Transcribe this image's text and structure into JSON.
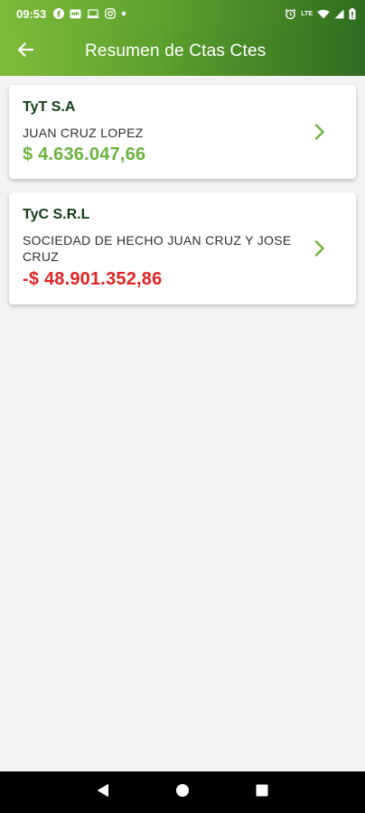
{
  "status_bar": {
    "time": "09:53",
    "network_label": "LTE",
    "icons": [
      "facebook-icon",
      "messages-icon",
      "laptop-icon",
      "instagram-icon",
      "dot-icon",
      "alarm-icon",
      "wifi-icon",
      "signal-icon",
      "battery-icon"
    ]
  },
  "app_bar": {
    "title": "Resumen de Ctas Ctes",
    "back_icon": "arrow-left-icon"
  },
  "accounts": [
    {
      "company": "TyT S.A",
      "holder": "JUAN CRUZ LOPEZ",
      "balance": "$ 4.636.047,66",
      "balance_color": "#6db33f"
    },
    {
      "company": "TyC S.R.L",
      "holder": "SOCIEDAD DE HECHO JUAN CRUZ Y JOSE CRUZ",
      "balance": "-$ 48.901.352,86",
      "balance_color": "#e02424"
    }
  ],
  "colors": {
    "accent_green": "#6db33f",
    "dark_green": "#2f6b20",
    "negative_red": "#e02424"
  },
  "nav_bar": {
    "icons": [
      "back-triangle-icon",
      "home-circle-icon",
      "recents-square-icon"
    ]
  }
}
